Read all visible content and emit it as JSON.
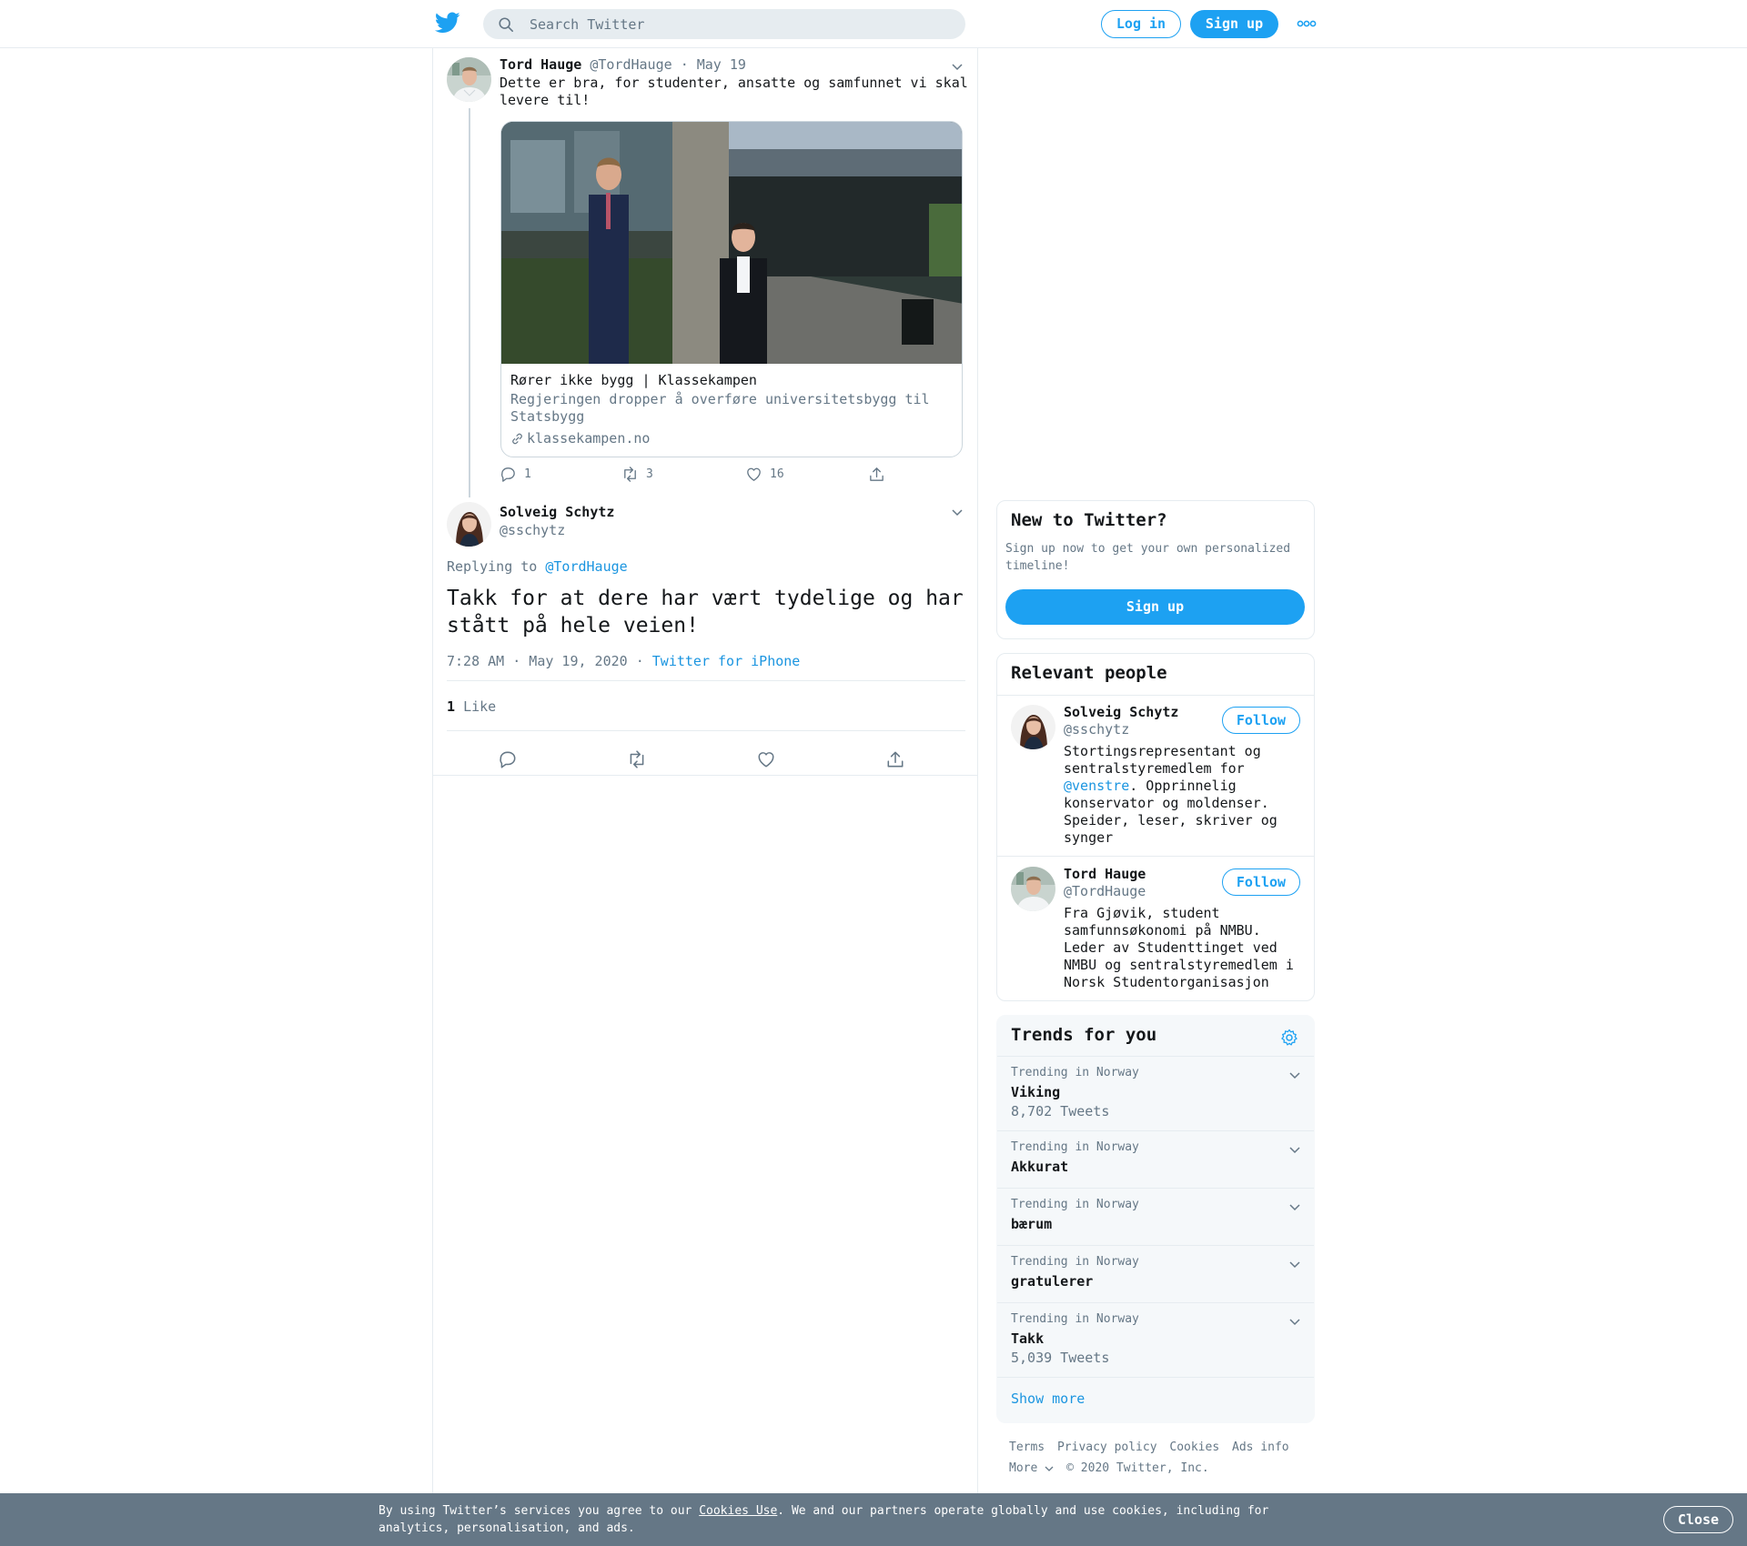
{
  "header": {
    "search_placeholder": "Search Twitter",
    "login_label": "Log in",
    "signup_label": "Sign up"
  },
  "tweet1": {
    "name": "Tord Hauge",
    "handle": "@TordHauge",
    "sep": "·",
    "date": "May 19",
    "text": "Dette er bra, for studenter, ansatte og samfunnet vi skal levere til!",
    "card": {
      "title": "Rører ikke bygg | Klassekampen",
      "description": "Regjeringen dropper å overføre universitetsbygg til Statsbygg",
      "domain": "klassekampen.no"
    },
    "replies": "1",
    "retweets": "3",
    "likes": "16"
  },
  "tweet2": {
    "name": "Solveig Schytz",
    "handle": "@sschytz",
    "replying_prefix": "Replying to",
    "replying_to": "@TordHauge",
    "text": "Takk for at dere har vært tydelige og har stått på hele veien!",
    "timestamp": "7:28 AM · May 19, 2020",
    "sep": "·",
    "source": "Twitter for iPhone",
    "like_count": "1",
    "like_label": "Like"
  },
  "sidebar": {
    "new_to_twitter": {
      "title": "New to Twitter?",
      "subtitle": "Sign up now to get your own personalized timeline!",
      "button": "Sign up"
    },
    "relevant_people": {
      "title": "Relevant people",
      "people": [
        {
          "name": "Solveig Schytz",
          "handle": "@sschytz",
          "follow": "Follow",
          "bio_before": "Stortingsrepresentant og sentralstyremedlem for ",
          "bio_mention": "@venstre",
          "bio_after": ". Opprinnelig konservator og moldenser. Speider, leser, skriver og synger"
        },
        {
          "name": "Tord Hauge",
          "handle": "@TordHauge",
          "follow": "Follow",
          "bio": "Fra Gjøvik, student samfunnsøkonomi på NMBU. Leder av Studenttinget ved NMBU og sentralstyremedlem i Norsk Studentorganisasjon"
        }
      ]
    },
    "trends": {
      "title": "Trends for you",
      "items": [
        {
          "context": "Trending in Norway",
          "name": "Viking",
          "count": "8,702 Tweets"
        },
        {
          "context": "Trending in Norway",
          "name": "Akkurat",
          "count": ""
        },
        {
          "context": "Trending in Norway",
          "name": "bærum",
          "count": ""
        },
        {
          "context": "Trending in Norway",
          "name": "gratulerer",
          "count": ""
        },
        {
          "context": "Trending in Norway",
          "name": "Takk",
          "count": "5,039 Tweets"
        }
      ],
      "show_more": "Show more"
    },
    "footer": {
      "links": [
        "Terms",
        "Privacy policy",
        "Cookies",
        "Ads info"
      ],
      "more": "More",
      "copyright": "© 2020 Twitter, Inc."
    }
  },
  "cookie_bar": {
    "text_before": "By using Twitter’s services you agree to our ",
    "link": "Cookies Use",
    "text_after": ". We and our partners operate globally and use cookies, including for analytics, personalisation, and ads.",
    "close": "Close"
  },
  "colors": {
    "accent": "#1da1f2",
    "link": "#1b95e0",
    "muted": "#657786",
    "border": "#e6ecf0",
    "cookie_bar": "#657786"
  }
}
